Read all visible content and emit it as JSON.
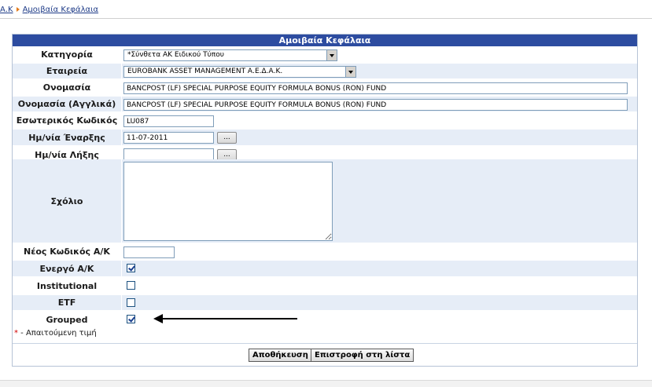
{
  "breadcrumb": {
    "parent": "Α.Κ",
    "current": "Αμοιβαία Κεφάλαια"
  },
  "panel": {
    "title": "Αμοιβαία Κεφάλαια"
  },
  "fields": {
    "category": {
      "label": "Κατηγορία",
      "value": "*Σύνθετα ΑΚ Ειδικού Τύπου"
    },
    "company": {
      "label": "Εταιρεία",
      "value": "EUROBANK ASSET MANAGEMENT Α.Ε.Δ.Α.Κ."
    },
    "name": {
      "label": "Ονομασία",
      "value": "BANCPOST (LF) SPECIAL PURPOSE EQUITY FORMULA BONUS (RON) FUND"
    },
    "name_en": {
      "label": "Ονομασία (Αγγλικά)",
      "value": "BANCPOST (LF) SPECIAL PURPOSE EQUITY FORMULA BONUS (RON) FUND"
    },
    "internal_code": {
      "label": "Εσωτερικός Κωδικός",
      "value": "LU087"
    },
    "start_date": {
      "label": "Ημ/νία Έναρξης",
      "value": "11-07-2011",
      "button": "..."
    },
    "end_date": {
      "label": "Ημ/νία Λήξης",
      "value": "",
      "button": "..."
    },
    "comment": {
      "label": "Σχόλιο",
      "value": ""
    },
    "new_code": {
      "label": "Νέος Κωδικός Α/Κ",
      "value": ""
    },
    "active": {
      "label": "Ενεργό Α/Κ",
      "checked": true
    },
    "institutional": {
      "label": "Institutional",
      "checked": false
    },
    "etf": {
      "label": "ETF",
      "checked": false
    },
    "grouped": {
      "label": "Grouped",
      "checked": true
    }
  },
  "required_note": {
    "star": "*",
    "text": " - Απαιτούμενη τιμή"
  },
  "buttons": {
    "save": "Αποθήκευση",
    "back": "Επιστροφή στη λίστα"
  },
  "colors": {
    "header_bg": "#2d4ca0",
    "row_alt": "#e6edf7",
    "checkbox_check": "#1a3f8f"
  },
  "icons": {
    "dropdown": "chevron-down-icon",
    "annotation": "arrow-left-icon"
  }
}
